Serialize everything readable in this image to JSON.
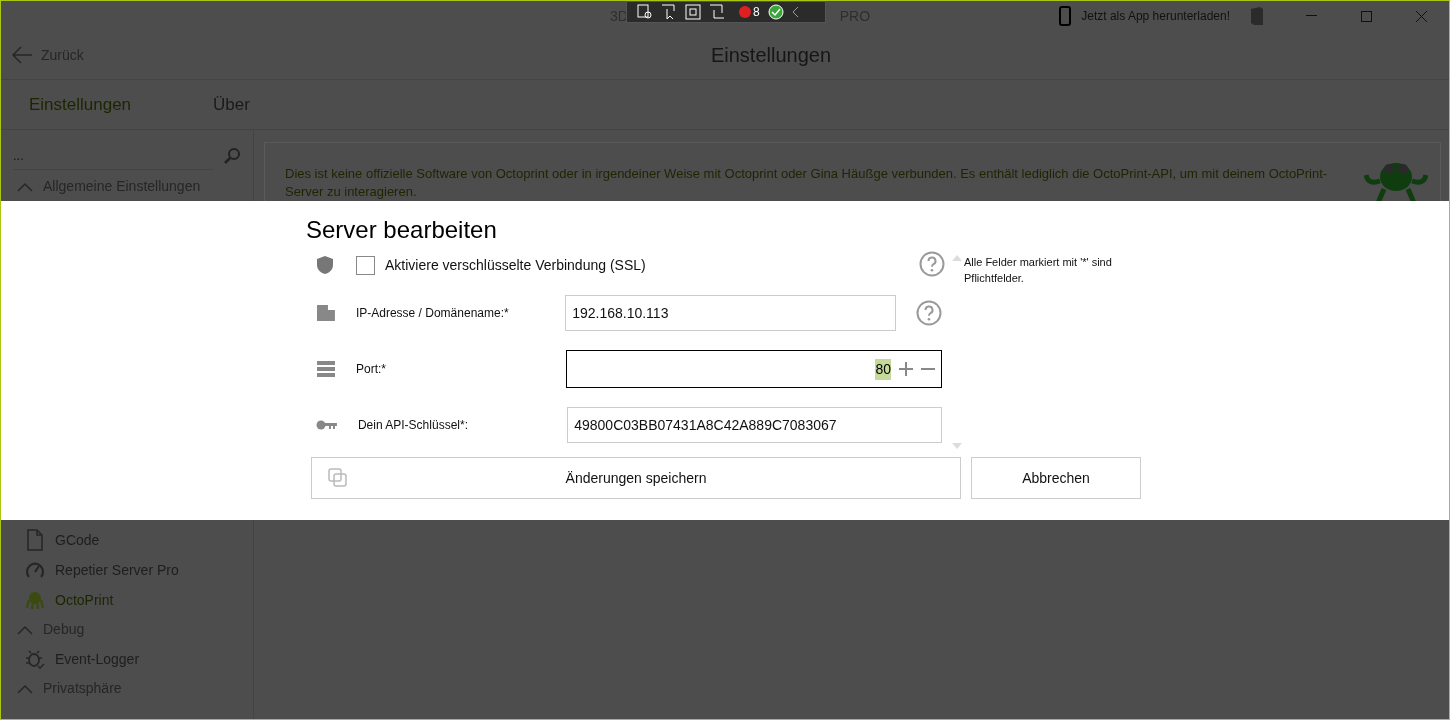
{
  "window": {
    "title_start": "3D",
    "title_end": "PRO",
    "download_link": "Jetzt als App herunterladen!"
  },
  "debug_toolbar": {
    "error_count": "8"
  },
  "header": {
    "back": "Zurück",
    "title": "Einstellungen"
  },
  "tabs": [
    {
      "label": "Einstellungen",
      "selected": true
    },
    {
      "label": "Über",
      "selected": false
    }
  ],
  "sidebar": {
    "search": {
      "placeholder": "..."
    },
    "top_items": [
      {
        "kind": "group",
        "label": "Allgemeine Einstellungen",
        "expanded": true
      }
    ],
    "bottom_items": [
      {
        "kind": "item",
        "label": "GCode",
        "selected": false
      },
      {
        "kind": "item",
        "label": "Repetier Server Pro",
        "selected": false
      },
      {
        "kind": "item",
        "label": "OctoPrint",
        "selected": true
      },
      {
        "kind": "group",
        "label": "Debug",
        "expanded": true
      },
      {
        "kind": "item",
        "label": "Event-Logger",
        "selected": false
      },
      {
        "kind": "group",
        "label": "Privatsphäre",
        "expanded": true
      }
    ]
  },
  "notice": {
    "text": "Dies ist keine offizielle Software von Octoprint oder in irgendeiner Weise mit Octoprint oder Gina Häußge verbunden. Es enthält lediglich die OctoPrint-API, um mit deinem OctoPrint-Server zu interagieren."
  },
  "dialog": {
    "title": "Server bearbeiten",
    "ssl": {
      "label": "Aktiviere verschlüsselte Verbindung (SSL)",
      "checked": false,
      "help": true
    },
    "fields": [
      {
        "kind": "text",
        "label": "IP-Adresse / Domänename:*",
        "value": "192.168.10.113",
        "help": true,
        "focused": false
      },
      {
        "kind": "number",
        "label": "Port:*",
        "value": "80",
        "help": false,
        "focused": true
      },
      {
        "kind": "text",
        "label": "Dein API-Schlüssel*:",
        "value": "49800C03BB07431A8C42A889C7083067",
        "help": false,
        "focused": false
      }
    ],
    "note": "Alle Felder markiert mit '*' sind Pflichtfelder.",
    "save_button": "Änderungen speichern",
    "cancel_button": "Abbrechen"
  }
}
